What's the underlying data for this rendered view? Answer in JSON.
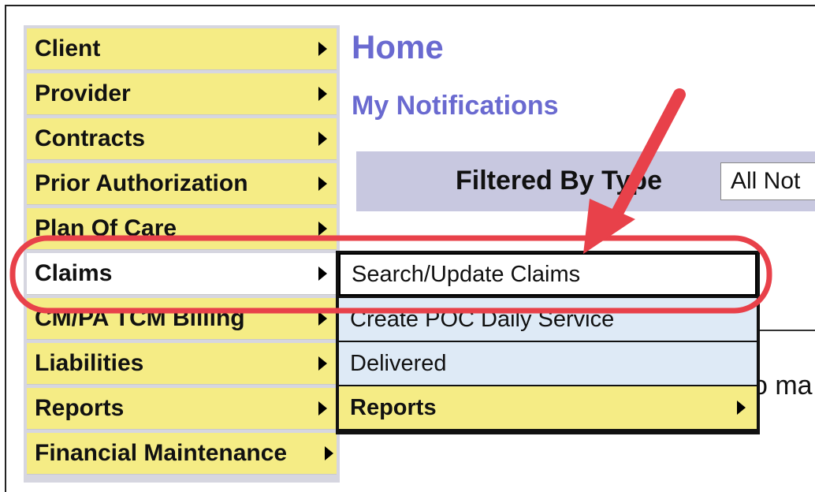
{
  "menu": {
    "items": [
      {
        "label": "Client"
      },
      {
        "label": "Provider"
      },
      {
        "label": "Contracts"
      },
      {
        "label": "Prior Authorization"
      },
      {
        "label": "Plan Of Care"
      },
      {
        "label": "Claims"
      },
      {
        "label": "CM/PA TCM Billing"
      },
      {
        "label": "Liabilities"
      },
      {
        "label": "Reports"
      },
      {
        "label": "Financial Maintenance"
      }
    ]
  },
  "content": {
    "home_title": "Home",
    "notifications_title": "My Notifications",
    "filter_label": "Filtered By Type",
    "filter_value": "All Not",
    "partial_text": "o ma"
  },
  "submenu": {
    "items": [
      {
        "label": "Search/Update Claims"
      },
      {
        "label": "Create POC Daily Service"
      },
      {
        "label": "Delivered"
      },
      {
        "label": "Reports"
      }
    ]
  },
  "colors": {
    "menu_bg": "#f5ec85",
    "title_color": "#6a6ad0",
    "annotation_red": "#e8414a"
  }
}
